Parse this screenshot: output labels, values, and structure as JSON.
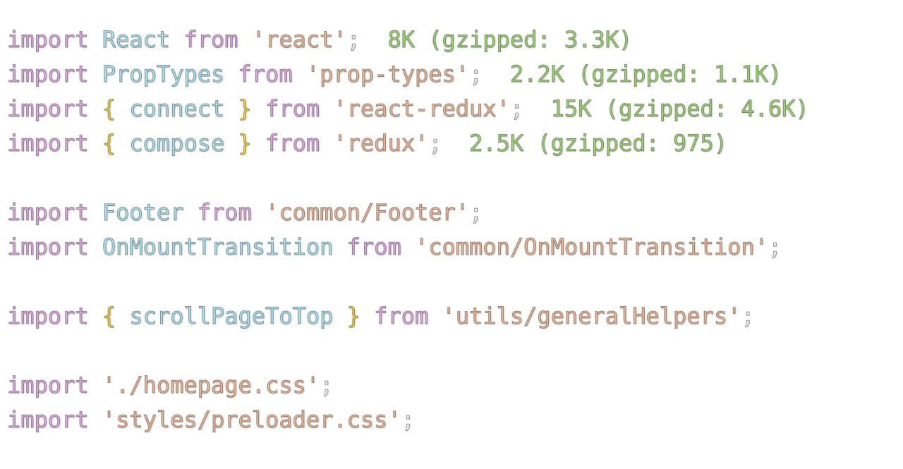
{
  "editor": {
    "lines": [
      {
        "tokens": [
          {
            "t": "import",
            "k": "kw"
          },
          {
            "t": " "
          },
          {
            "t": "React",
            "k": "id"
          },
          {
            "t": " "
          },
          {
            "t": "from",
            "k": "kw"
          },
          {
            "t": " "
          },
          {
            "t": "'react'",
            "k": "str"
          },
          {
            "t": ";",
            "k": "semi"
          }
        ],
        "size_hint": "8K (gzipped: 3.3K)"
      },
      {
        "tokens": [
          {
            "t": "import",
            "k": "kw"
          },
          {
            "t": " "
          },
          {
            "t": "PropTypes",
            "k": "id"
          },
          {
            "t": " "
          },
          {
            "t": "from",
            "k": "kw"
          },
          {
            "t": " "
          },
          {
            "t": "'prop-types'",
            "k": "str"
          },
          {
            "t": ";",
            "k": "semi"
          }
        ],
        "size_hint": "2.2K (gzipped: 1.1K)"
      },
      {
        "tokens": [
          {
            "t": "import",
            "k": "kw"
          },
          {
            "t": " "
          },
          {
            "t": "{",
            "k": "br"
          },
          {
            "t": " "
          },
          {
            "t": "connect",
            "k": "id"
          },
          {
            "t": " "
          },
          {
            "t": "}",
            "k": "br"
          },
          {
            "t": " "
          },
          {
            "t": "from",
            "k": "kw"
          },
          {
            "t": " "
          },
          {
            "t": "'react-redux'",
            "k": "str"
          },
          {
            "t": ";",
            "k": "semi"
          }
        ],
        "size_hint": "15K (gzipped: 4.6K)"
      },
      {
        "tokens": [
          {
            "t": "import",
            "k": "kw"
          },
          {
            "t": " "
          },
          {
            "t": "{",
            "k": "br"
          },
          {
            "t": " "
          },
          {
            "t": "compose",
            "k": "id"
          },
          {
            "t": " "
          },
          {
            "t": "}",
            "k": "br"
          },
          {
            "t": " "
          },
          {
            "t": "from",
            "k": "kw"
          },
          {
            "t": " "
          },
          {
            "t": "'redux'",
            "k": "str"
          },
          {
            "t": ";",
            "k": "semi"
          }
        ],
        "size_hint": "2.5K (gzipped: 975)"
      },
      {
        "tokens": []
      },
      {
        "tokens": [
          {
            "t": "import",
            "k": "kw"
          },
          {
            "t": " "
          },
          {
            "t": "Footer",
            "k": "id"
          },
          {
            "t": " "
          },
          {
            "t": "from",
            "k": "kw"
          },
          {
            "t": " "
          },
          {
            "t": "'common/Footer'",
            "k": "str"
          },
          {
            "t": ";",
            "k": "semi"
          }
        ]
      },
      {
        "tokens": [
          {
            "t": "import",
            "k": "kw"
          },
          {
            "t": " "
          },
          {
            "t": "OnMountTransition",
            "k": "id"
          },
          {
            "t": " "
          },
          {
            "t": "from",
            "k": "kw"
          },
          {
            "t": " "
          },
          {
            "t": "'common/OnMountTransition'",
            "k": "str"
          },
          {
            "t": ";",
            "k": "semi"
          }
        ]
      },
      {
        "tokens": []
      },
      {
        "tokens": [
          {
            "t": "import",
            "k": "kw"
          },
          {
            "t": " "
          },
          {
            "t": "{",
            "k": "br"
          },
          {
            "t": " "
          },
          {
            "t": "scrollPageToTop",
            "k": "id"
          },
          {
            "t": " "
          },
          {
            "t": "}",
            "k": "br"
          },
          {
            "t": " "
          },
          {
            "t": "from",
            "k": "kw"
          },
          {
            "t": " "
          },
          {
            "t": "'utils/generalHelpers'",
            "k": "str"
          },
          {
            "t": ";",
            "k": "semi"
          }
        ]
      },
      {
        "tokens": []
      },
      {
        "tokens": [
          {
            "t": "import",
            "k": "kw"
          },
          {
            "t": " "
          },
          {
            "t": "'./homepage.css'",
            "k": "str"
          },
          {
            "t": ";",
            "k": "semi"
          }
        ]
      },
      {
        "tokens": [
          {
            "t": "import",
            "k": "kw"
          },
          {
            "t": " "
          },
          {
            "t": "'styles/preloader.css'",
            "k": "str"
          },
          {
            "t": ";",
            "k": "semi"
          }
        ]
      }
    ]
  },
  "colors": {
    "keyword": "#e2a6e6",
    "identifier": "#a6e4f4",
    "string": "#eeb590",
    "brace": "#f6cf33",
    "semicolon": "#f2f2f2",
    "import_cost": "#9ad46c"
  }
}
